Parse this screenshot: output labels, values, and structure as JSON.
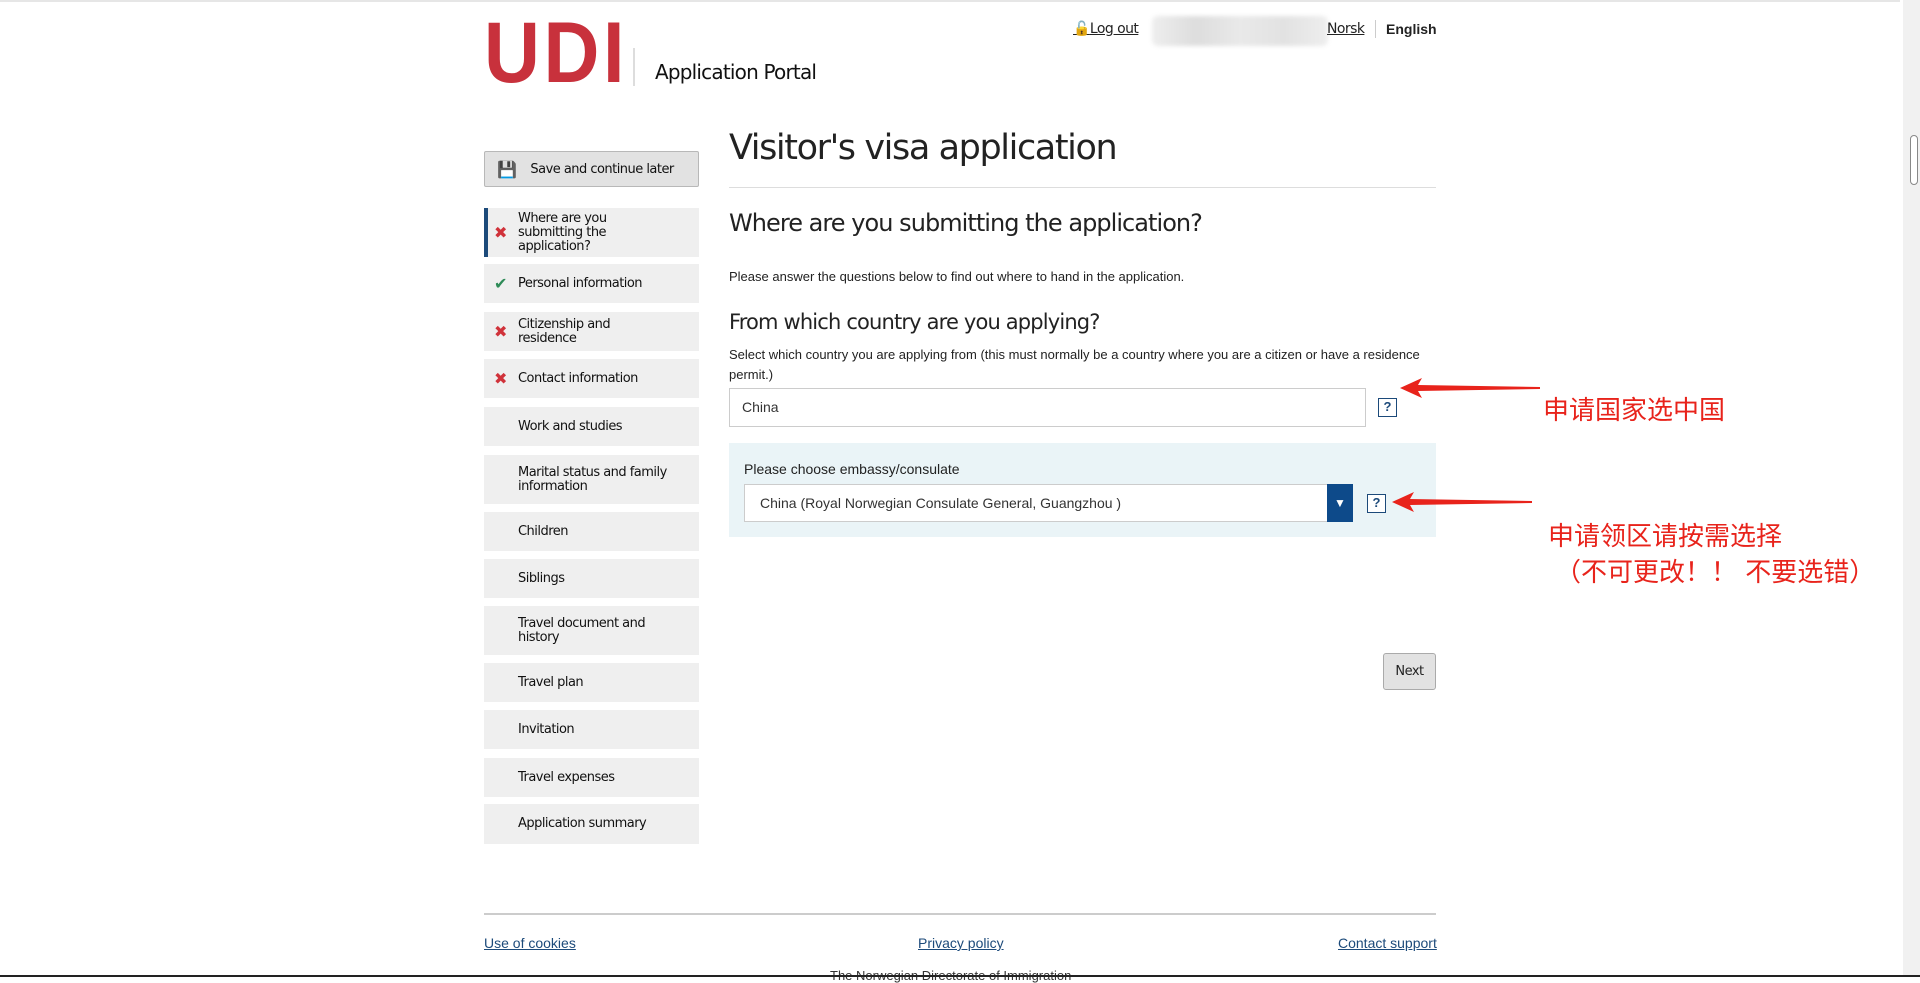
{
  "header": {
    "logo": "UDI",
    "portal_title": "Application Portal",
    "logout": "Log out",
    "lang_norsk": "Norsk",
    "lang_english": "English"
  },
  "sidebar": {
    "save_label": "Save and continue later",
    "items": [
      {
        "label": "Where are you submitting the application?",
        "status": "incomplete",
        "active": true
      },
      {
        "label": "Personal information",
        "status": "complete"
      },
      {
        "label": "Citizenship and residence",
        "status": "incomplete"
      },
      {
        "label": "Contact information",
        "status": "incomplete"
      },
      {
        "label": "Work and studies",
        "status": "none"
      },
      {
        "label": "Marital status and family information",
        "status": "none"
      },
      {
        "label": "Children",
        "status": "none"
      },
      {
        "label": "Siblings",
        "status": "none"
      },
      {
        "label": "Travel document and history",
        "status": "none"
      },
      {
        "label": "Travel plan",
        "status": "none"
      },
      {
        "label": "Invitation",
        "status": "none"
      },
      {
        "label": "Travel expenses",
        "status": "none"
      },
      {
        "label": "Application summary",
        "status": "none"
      }
    ]
  },
  "main": {
    "title": "Visitor's visa application",
    "section_title": "Where are you submitting the application?",
    "intro": "Please answer the questions below to find out where to hand in the application.",
    "country_question": "From which country are you applying?",
    "country_help": "Select which country you are applying from (this must normally be a country where you are a citizen or have a residence permit.)",
    "country_value": "China",
    "help_label": "?",
    "embassy_label": "Please choose embassy/consulate",
    "embassy_value": "China (Royal Norwegian Consulate General, Guangzhou )",
    "next_label": "Next"
  },
  "footer": {
    "cookies": "Use of cookies",
    "privacy": "Privacy policy",
    "support": "Contact support",
    "partial_text": "The Norwegian Directorate of Immigration"
  },
  "annotations": {
    "note1": "申请国家选中国",
    "note2": "申请领区请按需选择",
    "note3": "（不可更改！！ 不要选错）"
  },
  "colors": {
    "brand": "#c8313c",
    "accent": "#0d4a8a",
    "annotation": "#e8231b"
  }
}
